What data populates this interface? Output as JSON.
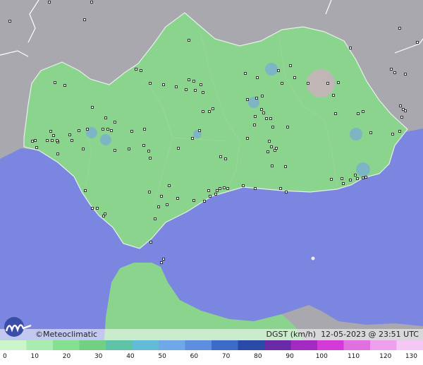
{
  "brand": {
    "copyright": "©Meteoclimatic"
  },
  "status": {
    "variable": "DGST (km/h)",
    "timestamp": "12-05-2023 @ 23:51 UTC"
  },
  "legend": {
    "ticks": [
      "0",
      "10",
      "20",
      "30",
      "40",
      "50",
      "60",
      "70",
      "80",
      "90",
      "100",
      "110",
      "120",
      "130"
    ],
    "colors": [
      "#ccf5cc",
      "#a8ecb0",
      "#86e092",
      "#72d082",
      "#5fc3a8",
      "#63bbd6",
      "#6ea8e8",
      "#5e8ee0",
      "#3d6cc8",
      "#2a4aa8",
      "#6a2aa8",
      "#a22ac0",
      "#d43ad8",
      "#e070e0",
      "#eea0ee",
      "#f4c8f4"
    ]
  },
  "colors": {
    "sea": "#7b86e0",
    "land_outside": "#a8a8ae",
    "region": "#8ad48e",
    "gust_spot": "#79a9dd",
    "high_gust_spot": "#d8aac8"
  }
}
